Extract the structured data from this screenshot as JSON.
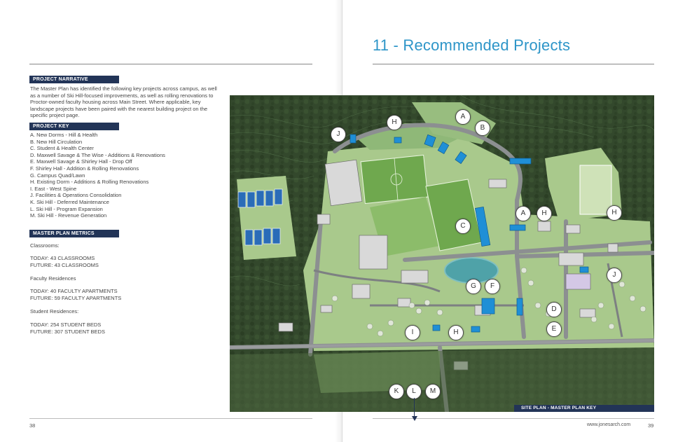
{
  "title": "11 - Recommended Projects",
  "narrative": {
    "heading": "PROJECT NARRATIVE",
    "text": "The Master Plan has identified the following key projects across campus, as well as a number of Ski Hill-focused improvements, as well as rolling renovations to Proctor-owned faculty housing across Main Street. Where applicable, key landscape projects have been paired with the nearest building project on the specific project page."
  },
  "project_key": {
    "heading": "PROJECT KEY",
    "items": [
      "A.  New Dorms - Hill & Health",
      "B.  New Hill Circulation",
      "C.  Student & Health Center",
      "D. Maxwell Savage & The Wise - Additions & Renovations",
      "E. Maxwell Savage & Shirley Hall - Drop Off",
      "F.  Shirley Hall - Addition & Rolling Renovations",
      "G. Campus Quad/Lawn",
      "H. Existing Dorm -  Additions & Rolling Renovations",
      "I.  East - West Spine",
      "J. Facilities & Operations Consolidation",
      "K. Ski Hill - Deferred Maintenance",
      "L. Ski Hill - Program Expansion",
      "M. Ski Hill - Revenue Generation"
    ]
  },
  "metrics": {
    "heading": "MASTER PLAN METRICS",
    "classrooms_label": "Classrooms:",
    "classrooms_today": "TODAY: 43 CLASSROOMS",
    "classrooms_future": "FUTURE: 43 CLASSROOMS",
    "faculty_label": "Faculty Residences",
    "faculty_today": "TODAY: 40 FACULTY APARTMENTS",
    "faculty_future": "FUTURE: 59 FACULTY APARTMENTS",
    "student_label": "Student Residences:",
    "student_today": "TODAY: 254 STUDENT BEDS",
    "student_future": "FUTURE: 307 STUDENT BEDS"
  },
  "map": {
    "caption": "SITE PLAN  - MASTER PLAN KEY",
    "markers": [
      "J",
      "H",
      "A",
      "B",
      "C",
      "A",
      "H",
      "H",
      "J",
      "G",
      "F",
      "D",
      "E",
      "I",
      "H",
      "K",
      "L",
      "M"
    ]
  },
  "footer": {
    "left_page": "38",
    "right_page": "39",
    "website": "www.jonesarch.com"
  },
  "colors": {
    "title": "#2d95c8",
    "section_heading_bg": "#223457",
    "project_buildings": "#1f8fd6"
  }
}
